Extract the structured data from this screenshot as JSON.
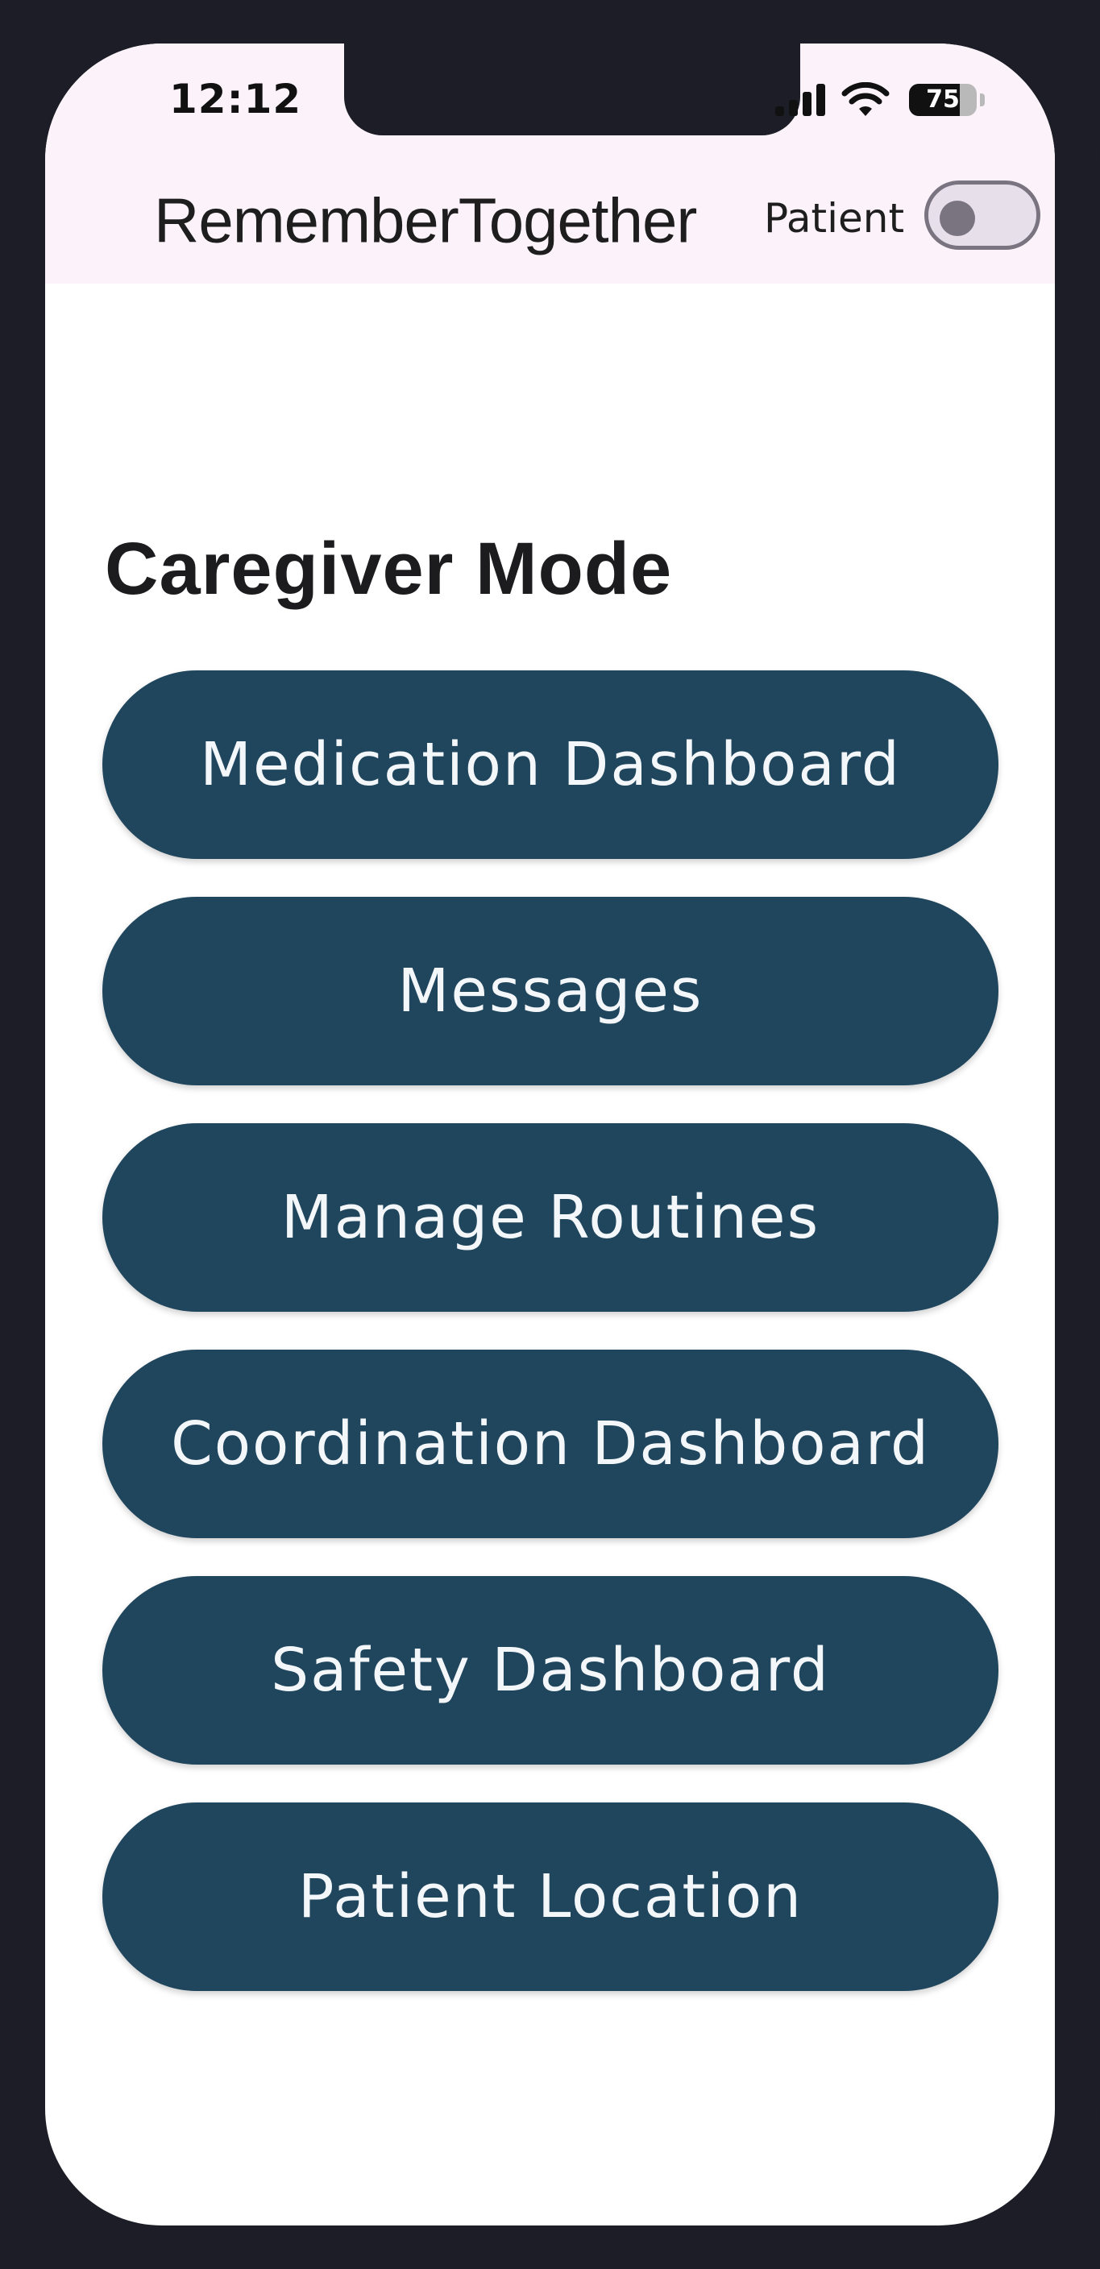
{
  "status_bar": {
    "time": "12:12",
    "battery_level": "75",
    "icons": [
      "signal-icon",
      "wifi-icon",
      "battery-icon"
    ]
  },
  "header": {
    "title": "RememberTogether",
    "toggle_label": "Patient",
    "toggle_on": false
  },
  "main": {
    "section_title": "Caregiver Mode",
    "buttons": [
      {
        "label": "Medication Dashboard"
      },
      {
        "label": "Messages"
      },
      {
        "label": "Manage Routines"
      },
      {
        "label": "Coordination Dashboard"
      },
      {
        "label": "Safety Dashboard"
      },
      {
        "label": "Patient Location"
      }
    ]
  },
  "colors": {
    "device_frame": "#1c1d26",
    "header_background": "#fcf3fa",
    "button_background": "#20465d",
    "button_text": "#f4f7fa",
    "toggle_track": "#e7e0ea",
    "toggle_outline": "#7a7380"
  }
}
